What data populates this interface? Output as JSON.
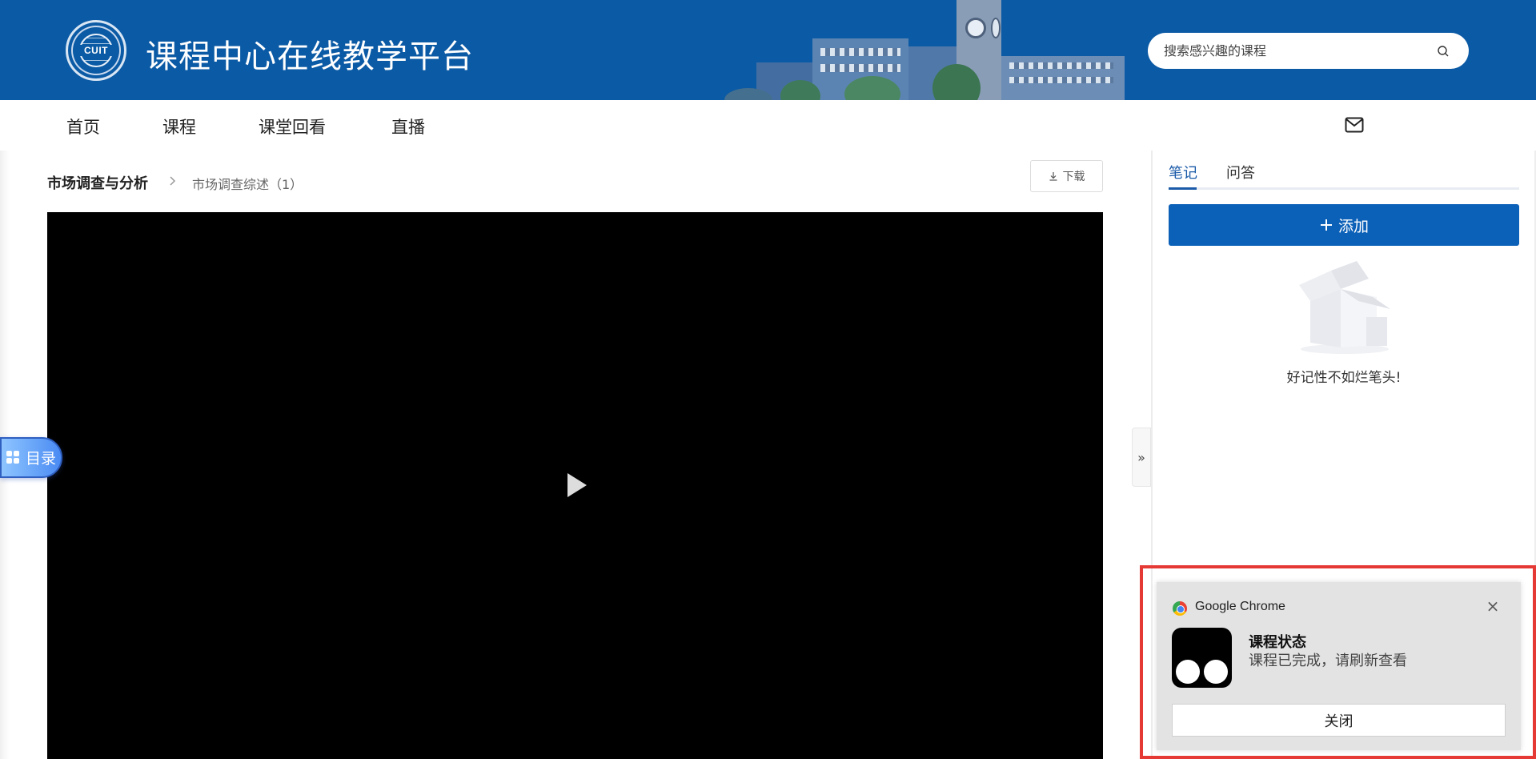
{
  "header": {
    "logo_text": "CUIT",
    "site_title": "课程中心在线教学平台",
    "search_placeholder": "搜索感兴趣的课程",
    "search_icon": "search-icon",
    "brand_color": "#0b5aa5"
  },
  "nav": {
    "items": [
      {
        "label": "首页"
      },
      {
        "label": "课程"
      },
      {
        "label": "课堂回看"
      },
      {
        "label": "直播"
      }
    ],
    "mail_icon": "mail-icon"
  },
  "breadcrumb": {
    "course": "市场调查与分析",
    "lesson": "市场调查综述（1）"
  },
  "toolbar": {
    "download_label": "下载",
    "download_icon": "download-icon"
  },
  "video": {
    "play_icon": "play-icon"
  },
  "catalog": {
    "label": "目录",
    "icon": "grid-icon"
  },
  "collapse": {
    "label": "»"
  },
  "panel": {
    "tabs": [
      {
        "label": "笔记",
        "active": true
      },
      {
        "label": "问答",
        "active": false
      }
    ],
    "add_label": "添加",
    "empty_text": "好记性不如烂笔头!",
    "accent_color": "#0b60b8"
  },
  "notification": {
    "app_name": "Google Chrome",
    "title": "课程状态",
    "body": "课程已完成，请刷新查看",
    "button_label": "关闭",
    "close_glyph": "×",
    "highlight_color": "#e53935"
  }
}
